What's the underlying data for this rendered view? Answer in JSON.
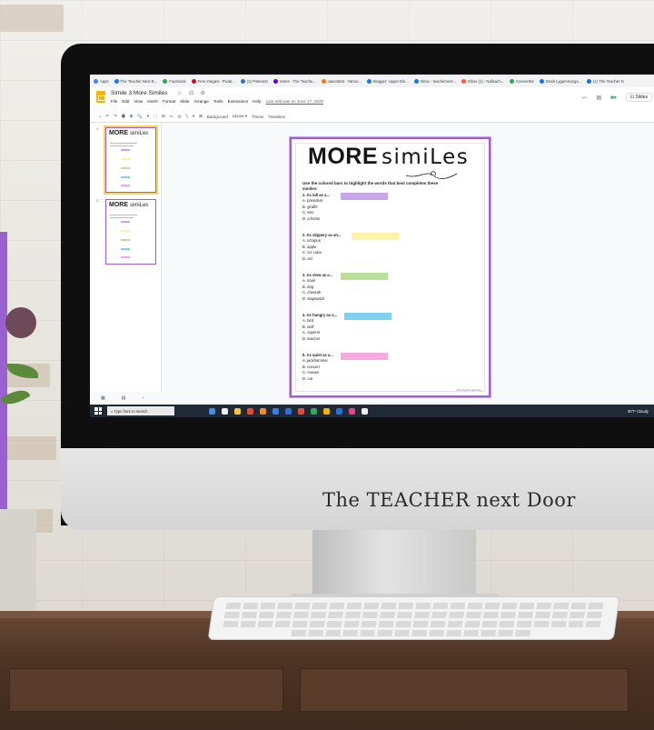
{
  "browser": {
    "bookmarks": [
      "Apps",
      "The Teacher Next D...",
      "Facebook",
      "Free Images - Pixab...",
      "(3) Pinterest",
      "Home - The Teache...",
      "Jason625 - Yahoo...",
      "Blogger: Upper Ele...",
      "Inbox - teachernext...",
      "Inbox (1) - Nalleach...",
      "ConvertKit",
      "Stock Lygammarga...",
      "(1) The Teacher N"
    ]
  },
  "slides_app": {
    "doc_title": "Simile 3 More Similes",
    "title_icons": "☆ ⊡ ⊘",
    "menu": [
      "File",
      "Edit",
      "View",
      "Insert",
      "Format",
      "Slide",
      "Arrange",
      "Tools",
      "Extensions",
      "Help"
    ],
    "last_edit": "Last edit was on June 17, 2020",
    "slides_button": "Slides",
    "toolbar": [
      "+",
      "↶",
      "↷",
      "🖶",
      "⊞",
      "🔍",
      "▾",
      "⬚",
      "⊟",
      "▭",
      "⬭",
      "╲",
      "▾",
      "⊞",
      "Background",
      "Layout ▾",
      "Theme",
      "Transition"
    ],
    "thumbnails": [
      {
        "num": "1",
        "title_bold": "MORE",
        "title_script": "simiLes"
      },
      {
        "num": "2",
        "title_bold": "MORE",
        "title_script": "simiLes"
      }
    ]
  },
  "slide": {
    "title_bold": "MORE",
    "title_script": "simiLes",
    "instructions": "Use the colored bars to highlight the words that best completes these similes:",
    "questions": [
      {
        "head": "1. As tall as a...",
        "color": "#c9a6ec",
        "options": [
          "A. president",
          "B. giraffe",
          "C. tree",
          "D. a horse"
        ]
      },
      {
        "head": "2. As slippery as an...",
        "color": "#fff3a8",
        "options": [
          "A. octopus",
          "B. apple",
          "C. ice cube",
          "D. eel"
        ]
      },
      {
        "head": "3. As slow as a...",
        "color": "#b9df9a",
        "options": [
          "A. snail",
          "B. dog",
          "C. cheetah",
          "D. stopwatch"
        ]
      },
      {
        "head": "4. As hungry as a...",
        "color": "#7fcfef",
        "options": [
          "A. bird",
          "B. wolf",
          "C. squirrel",
          "D. teacher"
        ]
      },
      {
        "head": "5. As quiet as a...",
        "color": "#f6a8e0",
        "options": [
          "A. jackhammer",
          "B. concert",
          "C. mouse",
          "D. cat"
        ]
      }
    ],
    "footer": "©The Teacher Next Door"
  },
  "taskbar": {
    "search_placeholder": "Type here to search",
    "weather": "30°F Cloudy"
  },
  "brand_logo": "The TEACHER next Door",
  "colors": {
    "accent_purple": "#9a5fd0",
    "taskbar": "#202a36",
    "slides_yellow": "#f4b400"
  }
}
